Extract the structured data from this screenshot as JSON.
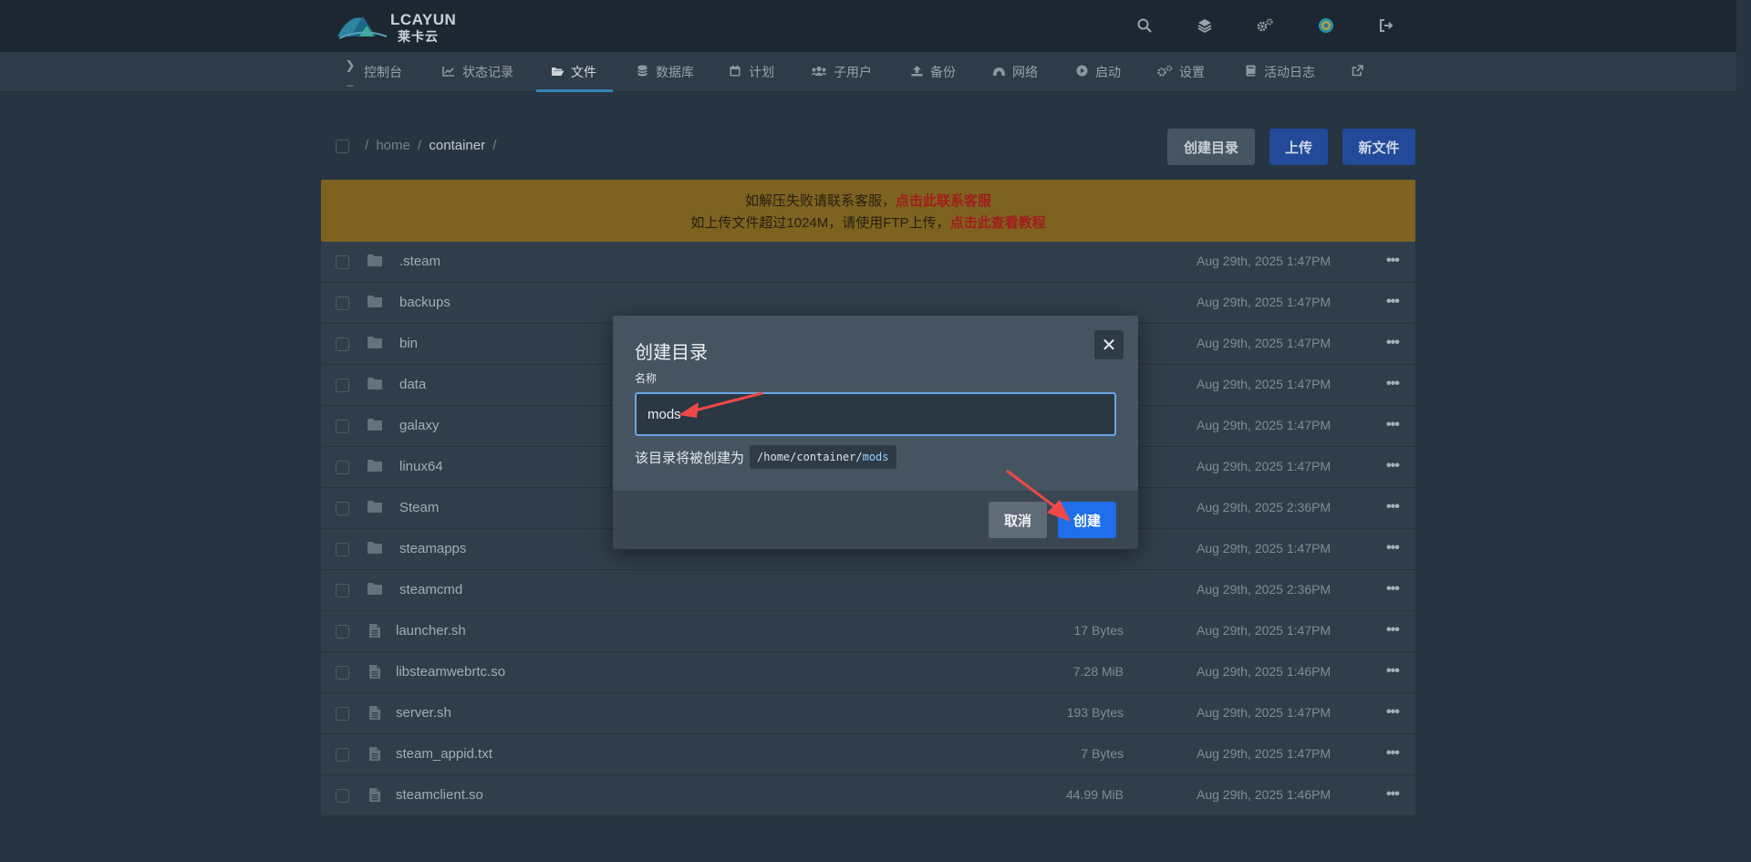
{
  "brand": {
    "name": "LCAYUN",
    "sub": "莱卡云"
  },
  "topbar": {
    "icons": [
      "search-icon",
      "layers-icon",
      "cogs-icon",
      "avatar",
      "logout-icon"
    ]
  },
  "nav": {
    "items": [
      {
        "label": "控制台",
        "icon": "terminal-icon"
      },
      {
        "label": "状态记录",
        "icon": "chart-icon"
      },
      {
        "label": "文件",
        "icon": "folder-open-icon",
        "active": true
      },
      {
        "label": "数据库",
        "icon": "database-icon"
      },
      {
        "label": "计划",
        "icon": "calendar-icon"
      },
      {
        "label": "子用户",
        "icon": "users-icon"
      },
      {
        "label": "备份",
        "icon": "upload-icon"
      },
      {
        "label": "网络",
        "icon": "network-icon"
      },
      {
        "label": "启动",
        "icon": "play-icon"
      },
      {
        "label": "设置",
        "icon": "cogs-icon"
      },
      {
        "label": "活动日志",
        "icon": "book-icon"
      },
      {
        "label": "",
        "icon": "external-link-icon"
      }
    ]
  },
  "breadcrumb": {
    "sep": "/",
    "parts": [
      "home",
      "container"
    ]
  },
  "actions": {
    "mkdir": "创建目录",
    "upload": "上传",
    "new_file": "新文件"
  },
  "notice": {
    "line1_text": "如解压失败请联系客服，",
    "line1_link": "点击此联系客服",
    "line2_text": "如上传文件超过1024M，请使用FTP上传，",
    "line2_link": "点击此查看教程"
  },
  "files": [
    {
      "name": ".steam",
      "type": "folder",
      "size": "",
      "date": "Aug 29th, 2025 1:47PM"
    },
    {
      "name": "backups",
      "type": "folder",
      "size": "",
      "date": "Aug 29th, 2025 1:47PM"
    },
    {
      "name": "bin",
      "type": "folder",
      "size": "",
      "date": "Aug 29th, 2025 1:47PM"
    },
    {
      "name": "data",
      "type": "folder",
      "size": "",
      "date": "Aug 29th, 2025 1:47PM"
    },
    {
      "name": "galaxy",
      "type": "folder",
      "size": "",
      "date": "Aug 29th, 2025 1:47PM"
    },
    {
      "name": "linux64",
      "type": "folder",
      "size": "",
      "date": "Aug 29th, 2025 1:47PM"
    },
    {
      "name": "Steam",
      "type": "folder",
      "size": "",
      "date": "Aug 29th, 2025 2:36PM"
    },
    {
      "name": "steamapps",
      "type": "folder",
      "size": "",
      "date": "Aug 29th, 2025 1:47PM"
    },
    {
      "name": "steamcmd",
      "type": "folder",
      "size": "",
      "date": "Aug 29th, 2025 2:36PM"
    },
    {
      "name": "launcher.sh",
      "type": "file",
      "size": "17 Bytes",
      "date": "Aug 29th, 2025 1:47PM"
    },
    {
      "name": "libsteamwebrtc.so",
      "type": "file",
      "size": "7.28 MiB",
      "date": "Aug 29th, 2025 1:46PM"
    },
    {
      "name": "server.sh",
      "type": "file",
      "size": "193 Bytes",
      "date": "Aug 29th, 2025 1:47PM"
    },
    {
      "name": "steam_appid.txt",
      "type": "file",
      "size": "7 Bytes",
      "date": "Aug 29th, 2025 1:47PM"
    },
    {
      "name": "steamclient.so",
      "type": "file",
      "size": "44.99 MiB",
      "date": "Aug 29th, 2025 1:46PM"
    }
  ],
  "modal": {
    "title": "创建目录",
    "field_label": "名称",
    "input_value": "mods",
    "hint": "该目录将被创建为",
    "path_prefix": "/home/container/",
    "path_name": "mods",
    "cancel": "取消",
    "create": "创建"
  },
  "colors": {
    "accent": "#1f6feb",
    "notice_bg": "#8a6b1f",
    "annotation_arrow": "#f04848"
  }
}
